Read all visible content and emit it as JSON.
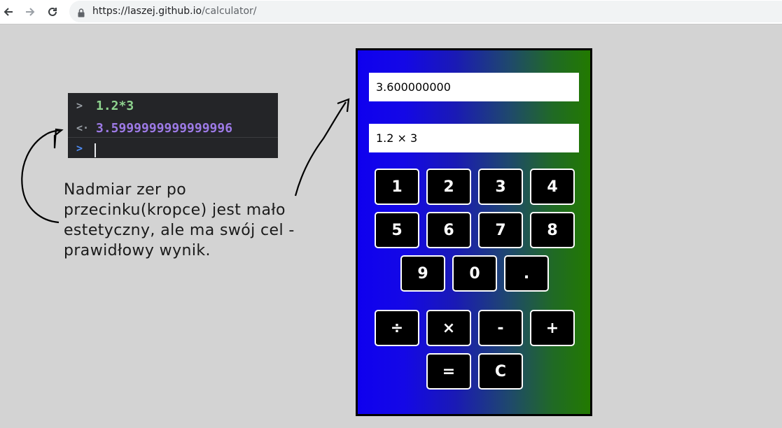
{
  "browser": {
    "url_host": "https://laszej.github.io",
    "url_path": "/calculator/"
  },
  "console": {
    "input": "1.2*3",
    "output": "3.5999999999999996"
  },
  "annotation": {
    "lines": [
      "Nadmiar zer po",
      "przecinku(kropce) jest mało",
      "estetyczny, ale ma swój cel -",
      "prawidłowy wynik."
    ]
  },
  "calculator": {
    "result": "3.600000000",
    "expression": "1.2 × 3",
    "digit_keys": [
      "1",
      "2",
      "3",
      "4",
      "5",
      "6",
      "7",
      "8",
      "9",
      "0",
      "."
    ],
    "operator_keys": [
      "÷",
      "×",
      "-",
      "+"
    ],
    "action_keys": [
      "=",
      "C"
    ]
  },
  "colors": {
    "gradient_left": "#0f00ef",
    "gradient_right": "#227a00",
    "key_background": "#000000",
    "key_border": "#ffffff",
    "page_background": "#d3d3d3",
    "console_background": "#242528",
    "console_input": "#8fd48f",
    "console_output": "#9d7ae6"
  }
}
